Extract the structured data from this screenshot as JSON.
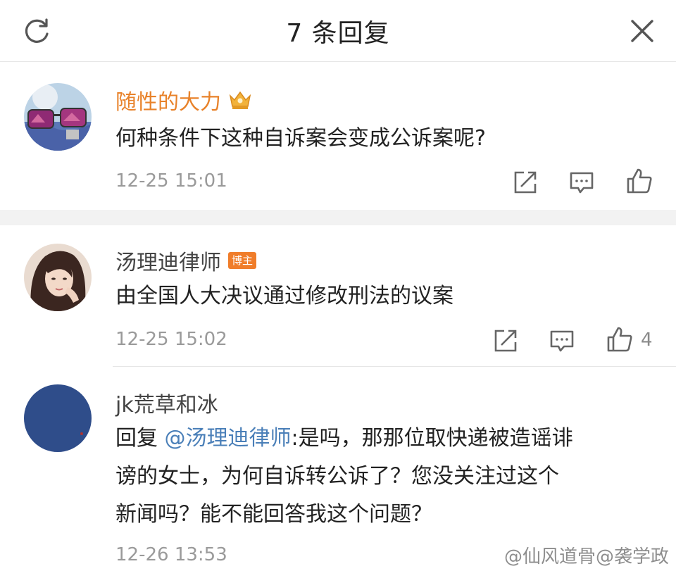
{
  "header": {
    "title": "7 条回复",
    "refresh_icon": "refresh-icon",
    "close_icon": "close-icon"
  },
  "comments": [
    {
      "name": "随性的大力",
      "name_color": "#e8822a",
      "badge_icon": "crown-icon",
      "text": "何种条件下这种自诉案会变成公诉案呢?",
      "time": "12-25 15:01",
      "like_count": ""
    },
    {
      "name": "汤理迪律师",
      "name_color": "#444444",
      "badge": "博主",
      "text": "由全国人大决议通过修改刑法的议案",
      "time": "12-25 15:02",
      "like_count": "4"
    },
    {
      "name": "jk荒草和冰",
      "name_color": "#444444",
      "reply_prefix": "回复 ",
      "mention": "@汤理迪律师",
      "text_line1": ":是吗，那那位取快递被造谣诽",
      "text_line2": "谤的女士，为何自诉转公诉了？您没关注过这个",
      "text_line3": "新闻吗？能不能回答我这个问题？",
      "time": "12-26 13:53"
    }
  ],
  "watermark": "@仙风道骨@袭学政",
  "colors": {
    "accent_orange": "#f07d2a",
    "mention_blue": "#4a7fb8",
    "meta_gray": "#9a9a9a",
    "band_gray": "#f2f2f2"
  }
}
